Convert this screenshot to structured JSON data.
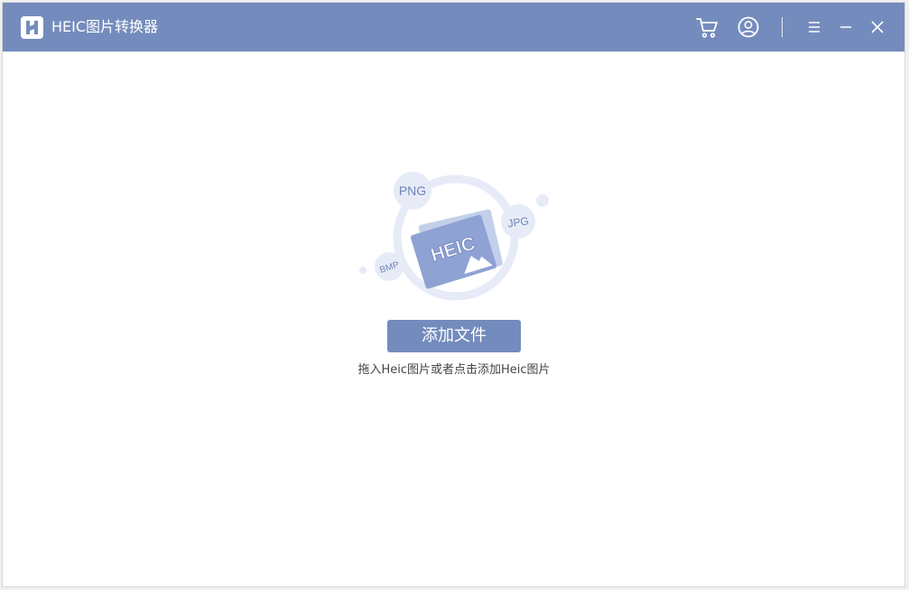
{
  "window": {
    "title": "HEIC图片转换器",
    "accent_color": "#748cbd"
  },
  "titlebar_icons": {
    "cart": "cart-icon",
    "account": "user-circle-icon",
    "menu": "menu-icon",
    "minimize": "minimize-icon",
    "close": "close-icon"
  },
  "illustration": {
    "main_label": "HEIC",
    "badges": [
      "PNG",
      "JPG",
      "BMP"
    ]
  },
  "main": {
    "add_button_label": "添加文件",
    "hint_text": "拖入Heic图片或者点击添加Heic图片"
  }
}
